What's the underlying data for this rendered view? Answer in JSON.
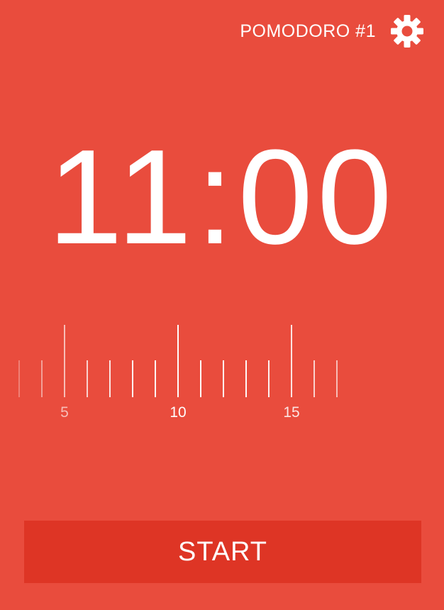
{
  "colors": {
    "background": "#e94c3d",
    "button": "#de3525",
    "foreground": "#ffffff"
  },
  "header": {
    "session_label": "POMODORO #1",
    "settings_icon": "gear-icon"
  },
  "timer": {
    "minutes": "11",
    "separator": ":",
    "seconds": "00"
  },
  "duration_selector": {
    "selected_minutes": 11,
    "tick_min": 1,
    "tick_max": 17,
    "labels": [
      {
        "value": 5,
        "text": "5"
      },
      {
        "value": 10,
        "text": "10"
      },
      {
        "value": 15,
        "text": "15"
      }
    ]
  },
  "start_button": {
    "label": "START"
  }
}
